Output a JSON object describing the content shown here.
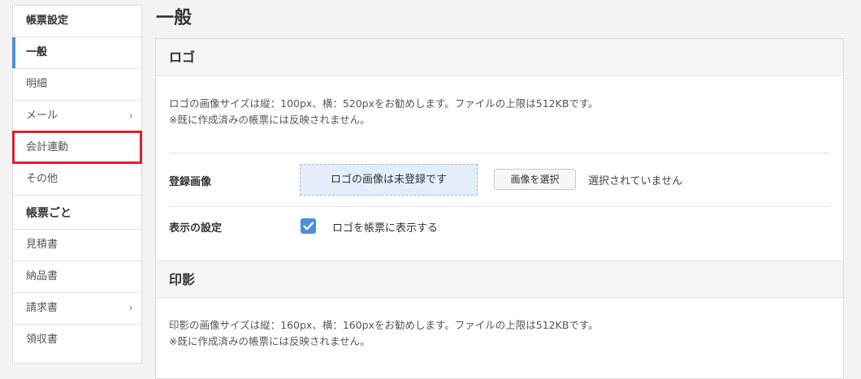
{
  "sidebar": {
    "heading": "帳票設定",
    "items": [
      {
        "label": "一般"
      },
      {
        "label": "明細"
      },
      {
        "label": "メール",
        "chevron": "›"
      },
      {
        "label": "会計連動"
      },
      {
        "label": "その他"
      }
    ],
    "heading2": "帳票ごと",
    "items2": [
      {
        "label": "見積書"
      },
      {
        "label": "納品書"
      },
      {
        "label": "請求書",
        "chevron": "›"
      },
      {
        "label": "領収書"
      }
    ]
  },
  "page": {
    "title": "一般"
  },
  "logo_section": {
    "title": "ロゴ",
    "desc1": "ロゴの画像サイズは縦：100px、横：520pxをお勧めします。ファイルの上限は512KBです。",
    "desc2": "※既に作成済みの帳票には反映されません。",
    "registered_label": "登録画像",
    "dropzone_text": "ロゴの画像は未登録です",
    "select_button": "画像を選択",
    "select_status": "選択されていません",
    "display_label": "表示の設定",
    "display_checkbox_label": "ロゴを帳票に表示する",
    "display_checked": true
  },
  "stamp_section": {
    "title": "印影",
    "desc1": "印影の画像サイズは縦：160px、横：160pxをお勧めします。ファイルの上限は512KBです。",
    "desc2": "※既に作成済みの帳票には反映されません。"
  },
  "colors": {
    "accent": "#4a90d9",
    "highlight": "#e0202c"
  }
}
